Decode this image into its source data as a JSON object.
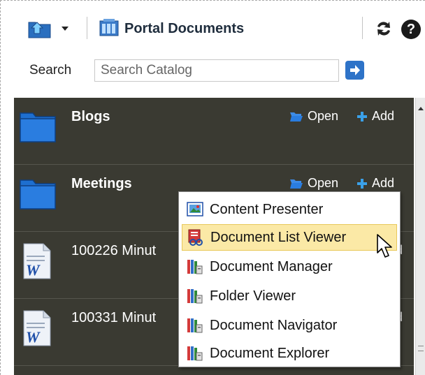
{
  "toolbar": {
    "breadcrumb_label": "Portal Documents",
    "home_icon": "folder-up-icon",
    "dropdown_icon": "chevron-down-icon",
    "refresh_icon": "refresh-icon",
    "help_icon": "help-icon",
    "help_glyph": "?"
  },
  "search": {
    "label": "Search",
    "placeholder": "Search Catalog",
    "value": ""
  },
  "catalog": {
    "rows": [
      {
        "title": "Blogs",
        "type": "folder",
        "open_label": "Open",
        "add_label": "Add"
      },
      {
        "title": "Meetings",
        "type": "folder",
        "open_label": "Open",
        "add_label": "Add"
      },
      {
        "title": "100226 Minut",
        "type": "word-document",
        "add_stub": "d"
      },
      {
        "title": "100331 Minut",
        "type": "word-document",
        "add_stub": "d"
      }
    ]
  },
  "menu": {
    "items": [
      {
        "label": "Content Presenter",
        "icon": "content-presenter-icon"
      },
      {
        "label": "Document List Viewer",
        "icon": "document-list-viewer-icon",
        "highlighted": true
      },
      {
        "label": "Document Manager",
        "icon": "document-manager-icon"
      },
      {
        "label": "Folder Viewer",
        "icon": "folder-viewer-icon"
      },
      {
        "label": "Document Navigator",
        "icon": "document-navigator-icon"
      },
      {
        "label": "Document Explorer",
        "icon": "document-explorer-icon"
      }
    ]
  },
  "colors": {
    "panel_bg": "#3a3a32",
    "accent_blue": "#2e73c8",
    "folder_blue": "#1e6fd0",
    "menu_highlight": "#fbe9a6",
    "add_plus": "#3aa0e8"
  }
}
